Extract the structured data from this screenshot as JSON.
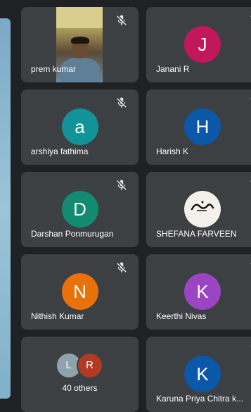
{
  "tiles": [
    {
      "name": "prem kumar",
      "type": "video"
    },
    {
      "name": "Janani R",
      "initial": "J",
      "color": "#c2185b"
    },
    {
      "name": "arshiya fathima",
      "initial": "a",
      "color": "#12939a"
    },
    {
      "name": "Harish K",
      "initial": "H",
      "color": "#0b57a8"
    },
    {
      "name": "Darshan Ponmurugan",
      "initial": "D",
      "color": "#138a72"
    },
    {
      "name": "SHEFANA FARVEEN",
      "type": "photo"
    },
    {
      "name": "Nithish Kumar",
      "initial": "N",
      "color": "#e8710a"
    },
    {
      "name": "Keerthi Nivas",
      "initial": "K",
      "color": "#9c45c4"
    },
    {
      "others_label": "40 others",
      "small_initials": [
        "L",
        "R"
      ],
      "small_colors": [
        "#8fa3ad",
        "#b03a23"
      ]
    },
    {
      "name": "Karuna Priya Chitra k...",
      "initial": "K",
      "color": "#0b57a8"
    }
  ],
  "icons": {
    "mic_muted": "mic-off-icon"
  }
}
